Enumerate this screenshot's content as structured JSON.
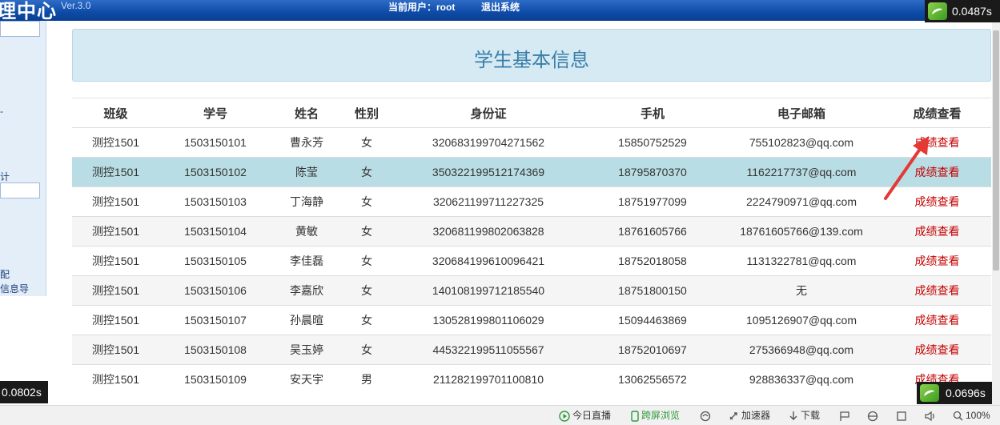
{
  "header": {
    "logo_fragment": "理中心",
    "version": "Ver.3.0",
    "current_user": "当前用户：root",
    "logout": "退出系统"
  },
  "sidebar": {
    "fragments": [
      "计",
      "配",
      "信息导"
    ],
    "misc": [
      "- "
    ]
  },
  "panel": {
    "title": "学生基本信息"
  },
  "table": {
    "headers": [
      "班级",
      "学号",
      "姓名",
      "性别",
      "身份证",
      "手机",
      "电子邮箱",
      "成绩查看"
    ],
    "rows": [
      [
        "测控1501",
        "1503150101",
        "曹永芳",
        "女",
        "320683199704271562",
        "15850752529",
        "755102823@qq.com",
        "成绩查看"
      ],
      [
        "测控1501",
        "1503150102",
        "陈莹",
        "女",
        "350322199512174369",
        "18795870370",
        "1162217737@qq.com",
        "成绩查看"
      ],
      [
        "测控1501",
        "1503150103",
        "丁海静",
        "女",
        "320621199711227325",
        "18751977099",
        "2224790971@qq.com",
        "成绩查看"
      ],
      [
        "测控1501",
        "1503150104",
        "黄敏",
        "女",
        "320681199802063828",
        "18761605766",
        "18761605766@139.com",
        "成绩查看"
      ],
      [
        "测控1501",
        "1503150105",
        "李佳磊",
        "女",
        "320684199610096421",
        "18752018058",
        "1131322781@qq.com",
        "成绩查看"
      ],
      [
        "测控1501",
        "1503150106",
        "李嘉欣",
        "女",
        "140108199712185540",
        "18751800150",
        "无",
        "成绩查看"
      ],
      [
        "测控1501",
        "1503150107",
        "孙晨暄",
        "女",
        "130528199801106029",
        "15094463869",
        "1095126907@qq.com",
        "成绩查看"
      ],
      [
        "测控1501",
        "1503150108",
        "吴玉婷",
        "女",
        "445322199511055567",
        "18752010697",
        "275366948@qq.com",
        "成绩查看"
      ],
      [
        "测控1501",
        "1503150109",
        "安天宇",
        "男",
        "211282199701100810",
        "13062556572",
        "928836337@qq.com",
        "成绩查看"
      ]
    ]
  },
  "overlays": {
    "top_right_speed": "0.0487s",
    "bottom_left_speed": "0.0802s",
    "bottom_right_speed": "0.0696s"
  },
  "statusbar": {
    "live": "今日直播",
    "cross_screen": "跨屏浏览",
    "accelerator": "加速器",
    "download": "下载",
    "zoom": "100%"
  },
  "colors": {
    "header_blue": "#0d4ba6",
    "panel_bg": "#d6eaf4",
    "highlight_row": "#b9dde4",
    "link_red": "#c40000"
  }
}
